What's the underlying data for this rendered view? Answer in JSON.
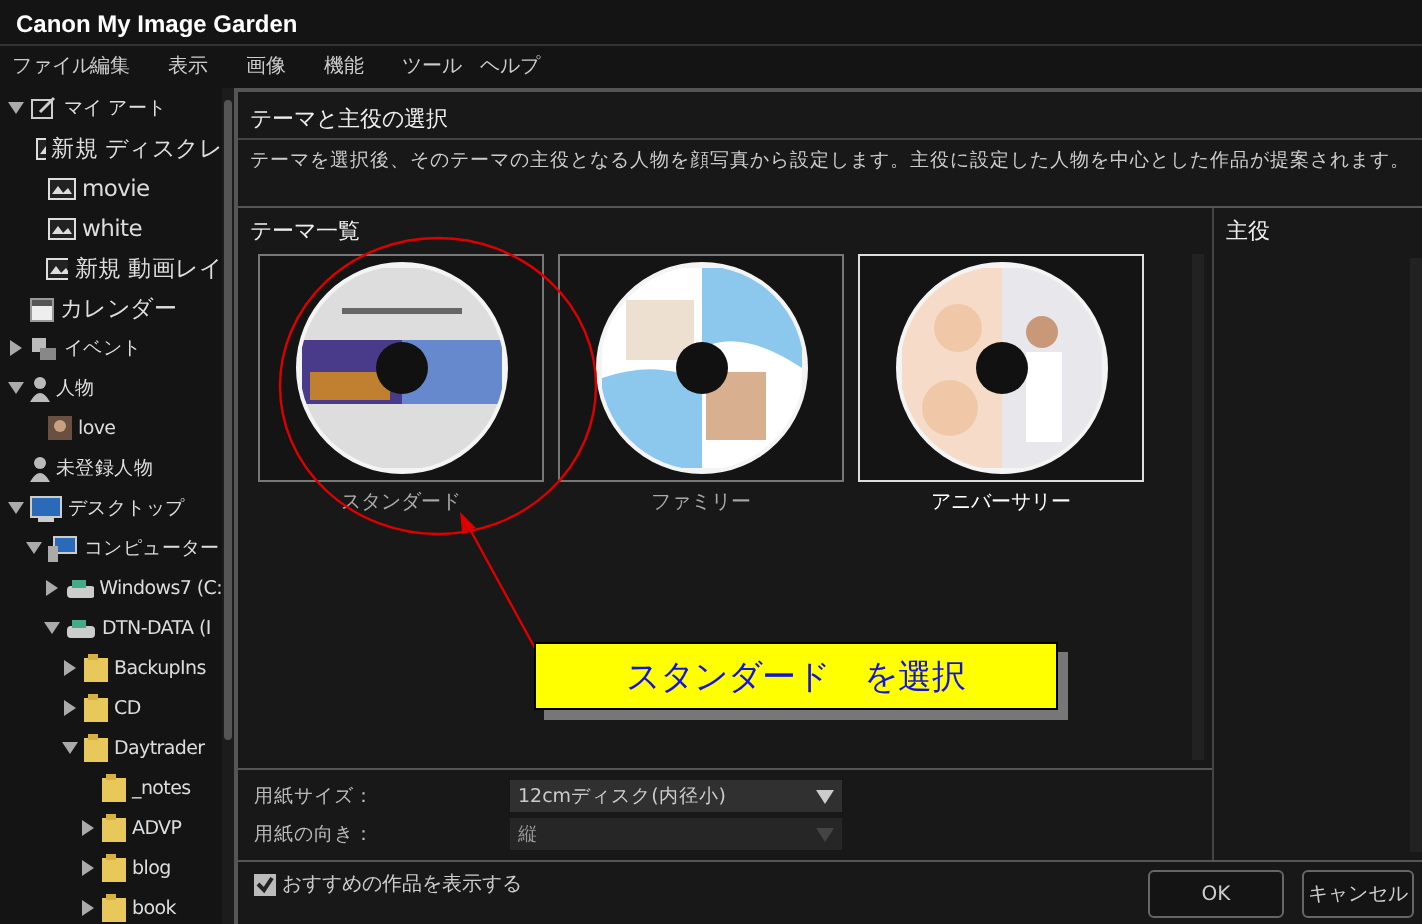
{
  "window": {
    "title": "Canon My Image Garden"
  },
  "menu": [
    "ファイル",
    "編集",
    "表示",
    "画像",
    "機能",
    "ツール",
    "ヘルプ"
  ],
  "sidebar": {
    "items": [
      {
        "label": "マイ アート",
        "kind": "art",
        "expanded": true,
        "children": [
          {
            "label": "新規 ディスクレ",
            "kind": "layout"
          },
          {
            "label": "movie",
            "kind": "layout"
          },
          {
            "label": "white",
            "kind": "layout"
          },
          {
            "label": "新規 動画レイ",
            "kind": "layout"
          }
        ]
      },
      {
        "label": "カレンダー",
        "kind": "calendar"
      },
      {
        "label": "イベント",
        "kind": "event",
        "expanded": false
      },
      {
        "label": "人物",
        "kind": "person",
        "expanded": true,
        "children": [
          {
            "label": "love",
            "kind": "face"
          }
        ]
      },
      {
        "label": "未登録人物",
        "kind": "person"
      },
      {
        "label": "デスクトップ",
        "kind": "desktop",
        "expanded": true,
        "children": [
          {
            "label": "コンピューター",
            "kind": "computer",
            "expanded": true,
            "children": [
              {
                "label": "Windows7 (C:",
                "kind": "drive",
                "expanded": false
              },
              {
                "label": "DTN-DATA (I",
                "kind": "drive",
                "expanded": true,
                "children": [
                  {
                    "label": "BackupIns",
                    "kind": "folder",
                    "expanded": false
                  },
                  {
                    "label": "CD",
                    "kind": "folder",
                    "expanded": false
                  },
                  {
                    "label": "Daytrader",
                    "kind": "folder",
                    "expanded": true,
                    "children": [
                      {
                        "label": "_notes",
                        "kind": "folder"
                      },
                      {
                        "label": "ADVP",
                        "kind": "folder",
                        "expanded": false
                      },
                      {
                        "label": "blog",
                        "kind": "folder",
                        "expanded": false
                      },
                      {
                        "label": "book",
                        "kind": "folder",
                        "expanded": false
                      }
                    ]
                  }
                ]
              }
            ]
          }
        ]
      }
    ]
  },
  "dialog": {
    "title": "テーマと主役の選択",
    "description": "テーマを選択後、そのテーマの主役となる人物を顔写真から設定します。主役に設定した人物を中心とした作品が提案されます。",
    "themes_heading": "テーマ一覧",
    "themes": [
      {
        "label": "スタンダード",
        "kind": "travel",
        "selected": false
      },
      {
        "label": "ファミリー",
        "kind": "baby",
        "selected": false
      },
      {
        "label": "アニバーサリー",
        "kind": "wedding",
        "selected": true
      }
    ],
    "lead_heading": "主役",
    "fields": [
      {
        "label": "用紙サイズ：",
        "value": "12cmディスク(内径小)",
        "disabled": false
      },
      {
        "label": "用紙の向き：",
        "value": "縦",
        "disabled": true
      }
    ],
    "checkbox": {
      "label": "おすすめの作品を表示する",
      "checked": true
    },
    "buttons": [
      "OK",
      "キャンセル"
    ]
  },
  "annotation": {
    "text": "スタンダード　を選択"
  }
}
